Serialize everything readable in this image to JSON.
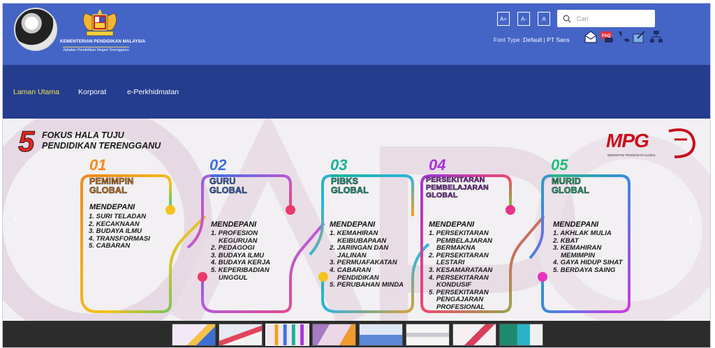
{
  "header": {
    "ministry_name": "KEMENTERIAN PENDIDIKAN MALAYSIA",
    "department_name": "Jabatan Pendidikan Negeri Terengganu",
    "font_size_buttons": [
      "A+",
      "A-",
      "A"
    ],
    "search_placeholder": "Cari",
    "font_type_label": "Font Type :",
    "font_options": [
      "Default",
      "PT Sans"
    ],
    "font_separator": " | ",
    "tool_icons": [
      "email-icon",
      "faq-icon",
      "phone-icon",
      "feedback-icon",
      "sitemap-icon"
    ]
  },
  "nav": {
    "items": [
      "Laman Utama",
      "Korporat",
      "e-Perkhidmatan"
    ],
    "active_index": 0
  },
  "banner": {
    "title_number": "5",
    "title_line1": "FOKUS HALA TUJU",
    "title_line2": "PENDIDIKAN TERENGGANU",
    "logo_text": "MPG",
    "logo_subtitle": "MENDEPANI PENDIDIKAN GLOBAL",
    "prev_arrow": "‹",
    "next_arrow": "›",
    "focus": [
      {
        "number": "01",
        "title": [
          "PEMIMPIN",
          "GLOBAL"
        ],
        "heading": "MENDEPANI",
        "items": [
          "1. SURI TELADAN",
          "2. KECAKNAAN",
          "3. BUDAYA ILMU",
          "4. TRANSFORMASI",
          "5. CABARAN"
        ]
      },
      {
        "number": "02",
        "title": [
          "GURU",
          "GLOBAL"
        ],
        "heading": "MENDEPANI",
        "items": [
          "1. PROFESION KEGURUAN",
          "2. PEDAGOGI",
          "3. BUDAYA ILMU",
          "4. BUDAYA KERJA",
          "5. KEPERIBADIAN UNGGUL"
        ]
      },
      {
        "number": "03",
        "title": [
          "PIBKS",
          "GLOBAL"
        ],
        "heading": "MENDEPANI",
        "items": [
          "1. KEMAHIRAN KEIBUBAPAAN",
          "2. JARINGAN DAN JALINAN",
          "3. PERMUAFAKATAN",
          "4. CABARAN PENDIDIKAN",
          "5. PERUBAHAN MINDA"
        ]
      },
      {
        "number": "04",
        "title": [
          "PERSEKITARAN",
          "PEMBELAJARAN",
          "GLOBAL"
        ],
        "heading": "MENDEPANI",
        "items": [
          "1. PERSEKITARAN PEMBELAJARAN BERMAKNA",
          "2. PERSEKITARAN LESTARI",
          "3. KESAMARATAAN",
          "4. PERSEKITARAN KONDUSIF",
          "5. PERSEKITARAN PENGAJARAN PROFESIONAL"
        ]
      },
      {
        "number": "05",
        "title": [
          "MURID",
          "GLOBAL"
        ],
        "heading": "MENDEPANI",
        "items": [
          "1. AKHLAK MULIA",
          "2. KBAT",
          "3. KEMAHIRAN MEMIMPIN",
          "4. GAYA HIDUP SIHAT",
          "5. BERDAYA SAING"
        ]
      }
    ]
  },
  "colors": {
    "header_bg": "#4565c6",
    "nav_bg": "#243d8e",
    "nav_active": "#f2e34a",
    "focus_colors": [
      "#f08a1c",
      "#3f6fe0",
      "#17b39a",
      "#a335d8",
      "#1fbf7a"
    ]
  },
  "thumbnails": {
    "count": 8,
    "active_index": 2
  }
}
